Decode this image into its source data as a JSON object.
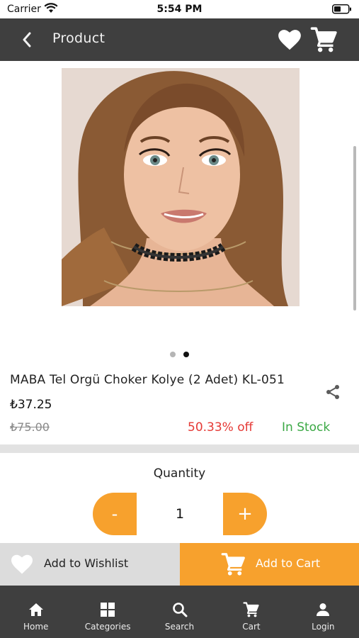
{
  "status_bar": {
    "carrier": "Carrier",
    "time": "5:54 PM"
  },
  "header": {
    "title": "Product"
  },
  "gallery": {
    "page_count": 2,
    "active_index": 1
  },
  "product": {
    "title": "MABA Tel Orgü Choker Kolye (2 Adet) KL-051",
    "price": "₺37.25",
    "old_price": "₺75.00",
    "discount": "50.33% off",
    "stock": "In Stock"
  },
  "quantity": {
    "label": "Quantity",
    "value": "1",
    "minus": "-",
    "plus": "+"
  },
  "actions": {
    "wishlist": "Add to Wishlist",
    "cart": "Add to Cart"
  },
  "bottom_nav": {
    "items": [
      {
        "label": "Home",
        "icon": "home-icon"
      },
      {
        "label": "Categories",
        "icon": "grid-icon"
      },
      {
        "label": "Search",
        "icon": "search-icon"
      },
      {
        "label": "Cart",
        "icon": "cart-icon"
      },
      {
        "label": "Login",
        "icon": "user-icon"
      }
    ]
  },
  "colors": {
    "bar": "#3f3f3f",
    "accent": "#f7a12d",
    "discount": "#e53935",
    "in_stock": "#3aa844",
    "wish_bg": "#dcdcdc"
  }
}
